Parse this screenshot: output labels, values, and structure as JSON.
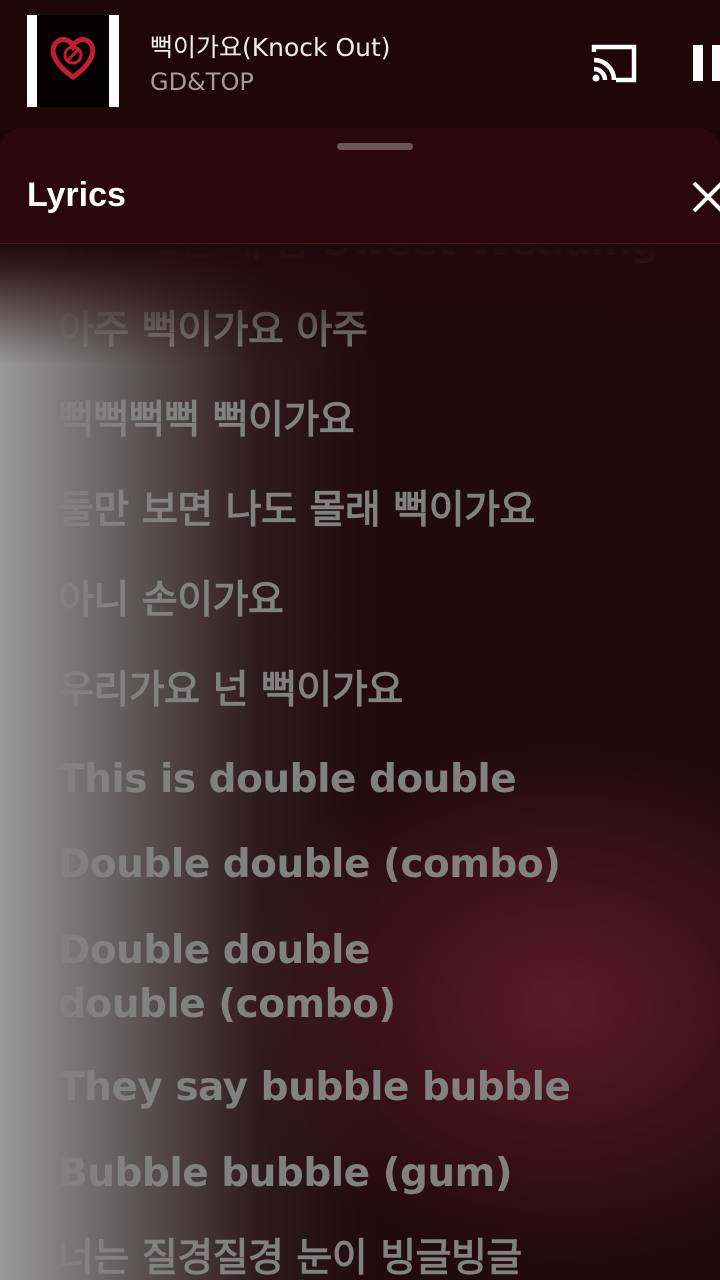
{
  "now_playing": {
    "title": "뻑이가요(Knock Out)",
    "artist": "GD&TOP",
    "cast_icon": "cast-icon",
    "pause_icon": "pause-icon"
  },
  "lyrics_panel": {
    "title": "Lyrics",
    "close_icon": "close-icon",
    "lines": [
      "귀 막으면 내 맘 Sweet Wedding",
      "아주 뻑이가요 아주",
      "뻑뻑뻑뻑 뻑이가요",
      "둘만 보면 나도 몰래 뻑이가요",
      "아니 손이가요",
      "우리가요 넌 뻑이가요",
      "This is double double",
      "Double double (combo)",
      "Double double double (combo)",
      "They say bubble bubble",
      "Bubble bubble (gum)",
      "너는 질경질경 눈이 빙글빙글"
    ]
  },
  "colors": {
    "background": "#1a0508",
    "header": "#2a070c",
    "lyric_text": "#828080",
    "title_text": "#ffffff"
  }
}
